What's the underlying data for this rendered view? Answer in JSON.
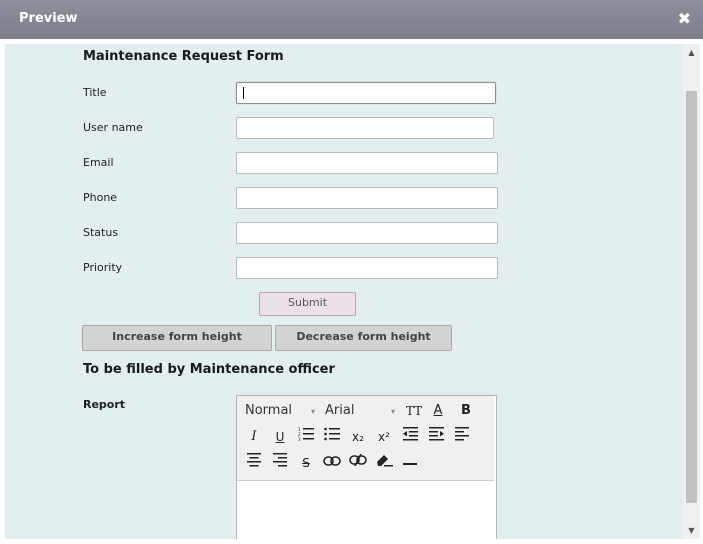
{
  "window": {
    "title": "Preview",
    "close_glyph": "✖"
  },
  "form": {
    "title": "Maintenance Request Form",
    "fields": [
      {
        "label": "Title",
        "value": ""
      },
      {
        "label": "User name",
        "value": ""
      },
      {
        "label": "Email",
        "value": ""
      },
      {
        "label": "Phone",
        "value": ""
      },
      {
        "label": "Status",
        "value": ""
      },
      {
        "label": "Priority",
        "value": ""
      }
    ],
    "submit_label": "Submit",
    "increase_label": "Increase form height",
    "decrease_label": "Decrease form height"
  },
  "officer_section": {
    "heading": "To be filled by Maintenance officer",
    "report_label": "Report"
  },
  "editor": {
    "format_value": "Normal",
    "font_value": "Arial",
    "bold_glyph": "B",
    "text_color_glyph": "A",
    "font_size_glyph": "TT",
    "italic_glyph": "I",
    "underline_glyph": "U",
    "subscript_glyph": "x₂",
    "superscript_glyph": "x²",
    "strike_glyph": "S",
    "dropdown_glyph": "▾",
    "content": ""
  },
  "scrollbar": {
    "up_glyph": "▲",
    "down_glyph": "▼"
  }
}
